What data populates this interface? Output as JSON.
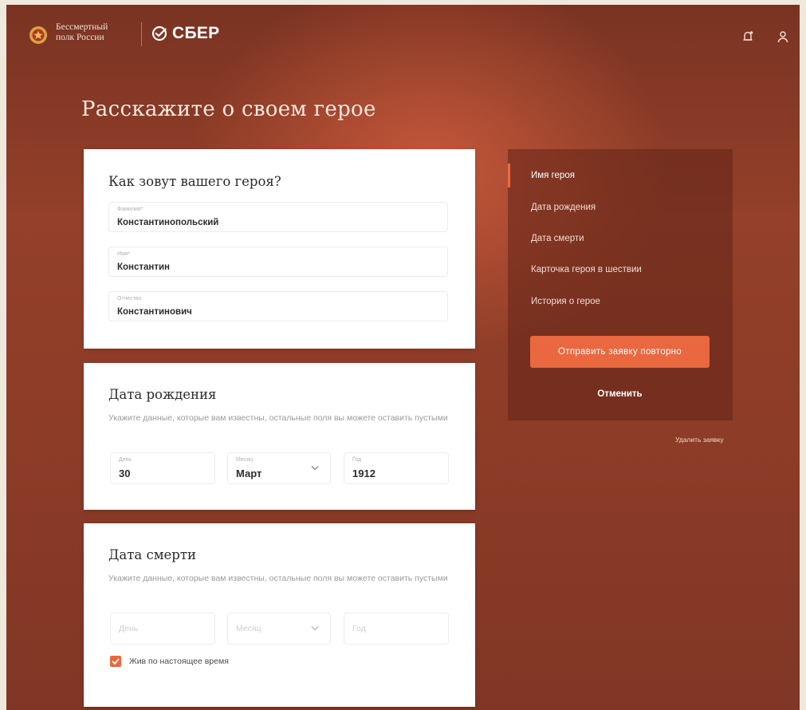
{
  "header": {
    "brand_line1": "Бессмертный",
    "brand_line2": "полк России",
    "sber_label": "СБЕР"
  },
  "page": {
    "title": "Расскажите о своем герое"
  },
  "name_section": {
    "title": "Как зовут вашего героя?",
    "surname": {
      "label": "Фамилия*",
      "value": "Константинопольский"
    },
    "first_name": {
      "label": "Имя*",
      "value": "Константин"
    },
    "patronymic": {
      "label": "Отчество",
      "value": "Константинович"
    }
  },
  "birth_section": {
    "title": "Дата рождения",
    "hint": "Укажите данные, которые вам известны, остальные поля вы можете оставить пустыми",
    "day": {
      "label": "День",
      "value": "30"
    },
    "month": {
      "label": "Месяц",
      "value": "Март"
    },
    "year": {
      "label": "Год",
      "value": "1912"
    }
  },
  "death_section": {
    "title": "Дата смерти",
    "hint": "Укажите данные, которые вам известны, остальные поля вы можете оставить пустыми",
    "day_placeholder": "День",
    "month_placeholder": "Месяц",
    "year_placeholder": "Год",
    "alive_label": "Жив по настоящее время",
    "alive_checked": true
  },
  "sidebar": {
    "items": [
      {
        "label": "Имя героя",
        "active": true
      },
      {
        "label": "Дата рождения",
        "active": false
      },
      {
        "label": "Дата смерти",
        "active": false
      },
      {
        "label": "Карточка героя в шествии",
        "active": false
      },
      {
        "label": "История о герое",
        "active": false
      }
    ],
    "resend_label": "Отправить заявку повторно",
    "cancel_label": "Отменить",
    "delete_label": "Удалить заявку"
  },
  "colors": {
    "accent": "#ea6840",
    "background": "#8d3c27",
    "card": "#ffffff"
  },
  "icons": [
    "emblem-icon",
    "sber-logo-icon",
    "bell-icon",
    "user-icon",
    "chevron-down-icon",
    "checkmark-icon"
  ]
}
